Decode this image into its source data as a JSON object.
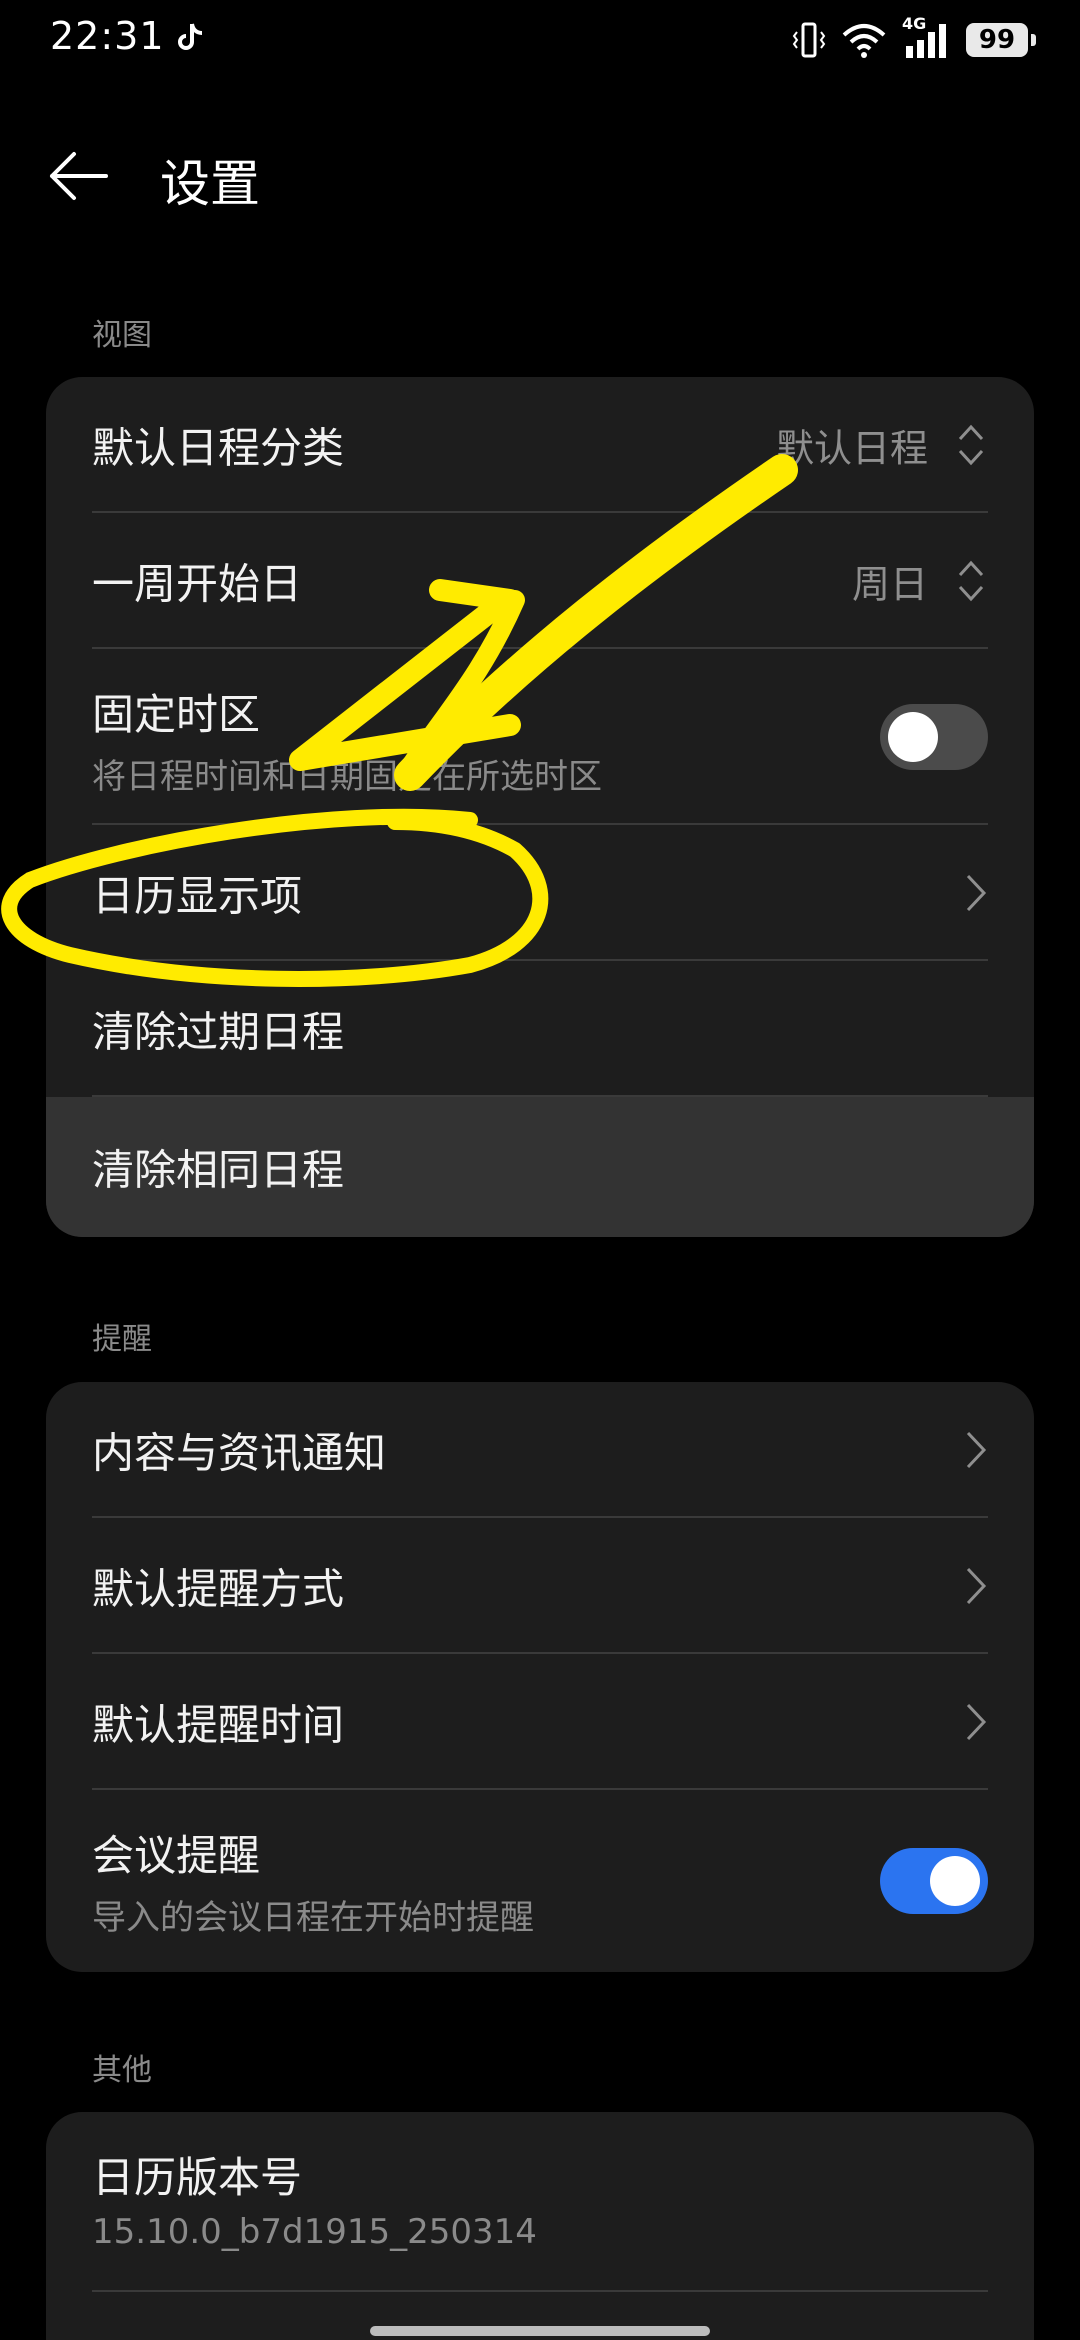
{
  "status_bar": {
    "time": "22:31",
    "battery": "99",
    "network": "4G"
  },
  "header": {
    "title": "设置"
  },
  "sections": {
    "view": {
      "title": "视图"
    },
    "remind": {
      "title": "提醒"
    },
    "other": {
      "title": "其他"
    }
  },
  "view_items": {
    "default_category": {
      "label": "默认日程分类",
      "value": "默认日程"
    },
    "week_start": {
      "label": "一周开始日",
      "value": "周日"
    },
    "fixed_timezone": {
      "label": "固定时区",
      "sub": "将日程时间和日期固定在所选时区",
      "enabled": false
    },
    "display_items": {
      "label": "日历显示项"
    },
    "clear_expired": {
      "label": "清除过期日程"
    },
    "clear_duplicates": {
      "label": "清除相同日程"
    }
  },
  "remind_items": {
    "content_notify": {
      "label": "内容与资讯通知"
    },
    "default_method": {
      "label": "默认提醒方式"
    },
    "default_time": {
      "label": "默认提醒时间"
    },
    "meeting": {
      "label": "会议提醒",
      "sub": "导入的会议日程在开始时提醒",
      "enabled": true
    }
  },
  "other_items": {
    "version": {
      "label": "日历版本号",
      "sub": "15.10.0_b7d1915_250314"
    }
  },
  "colors": {
    "accent": "#2b74f0",
    "annotation": "#ffeb00",
    "background": "#000000",
    "card": "#1d1d1d"
  }
}
